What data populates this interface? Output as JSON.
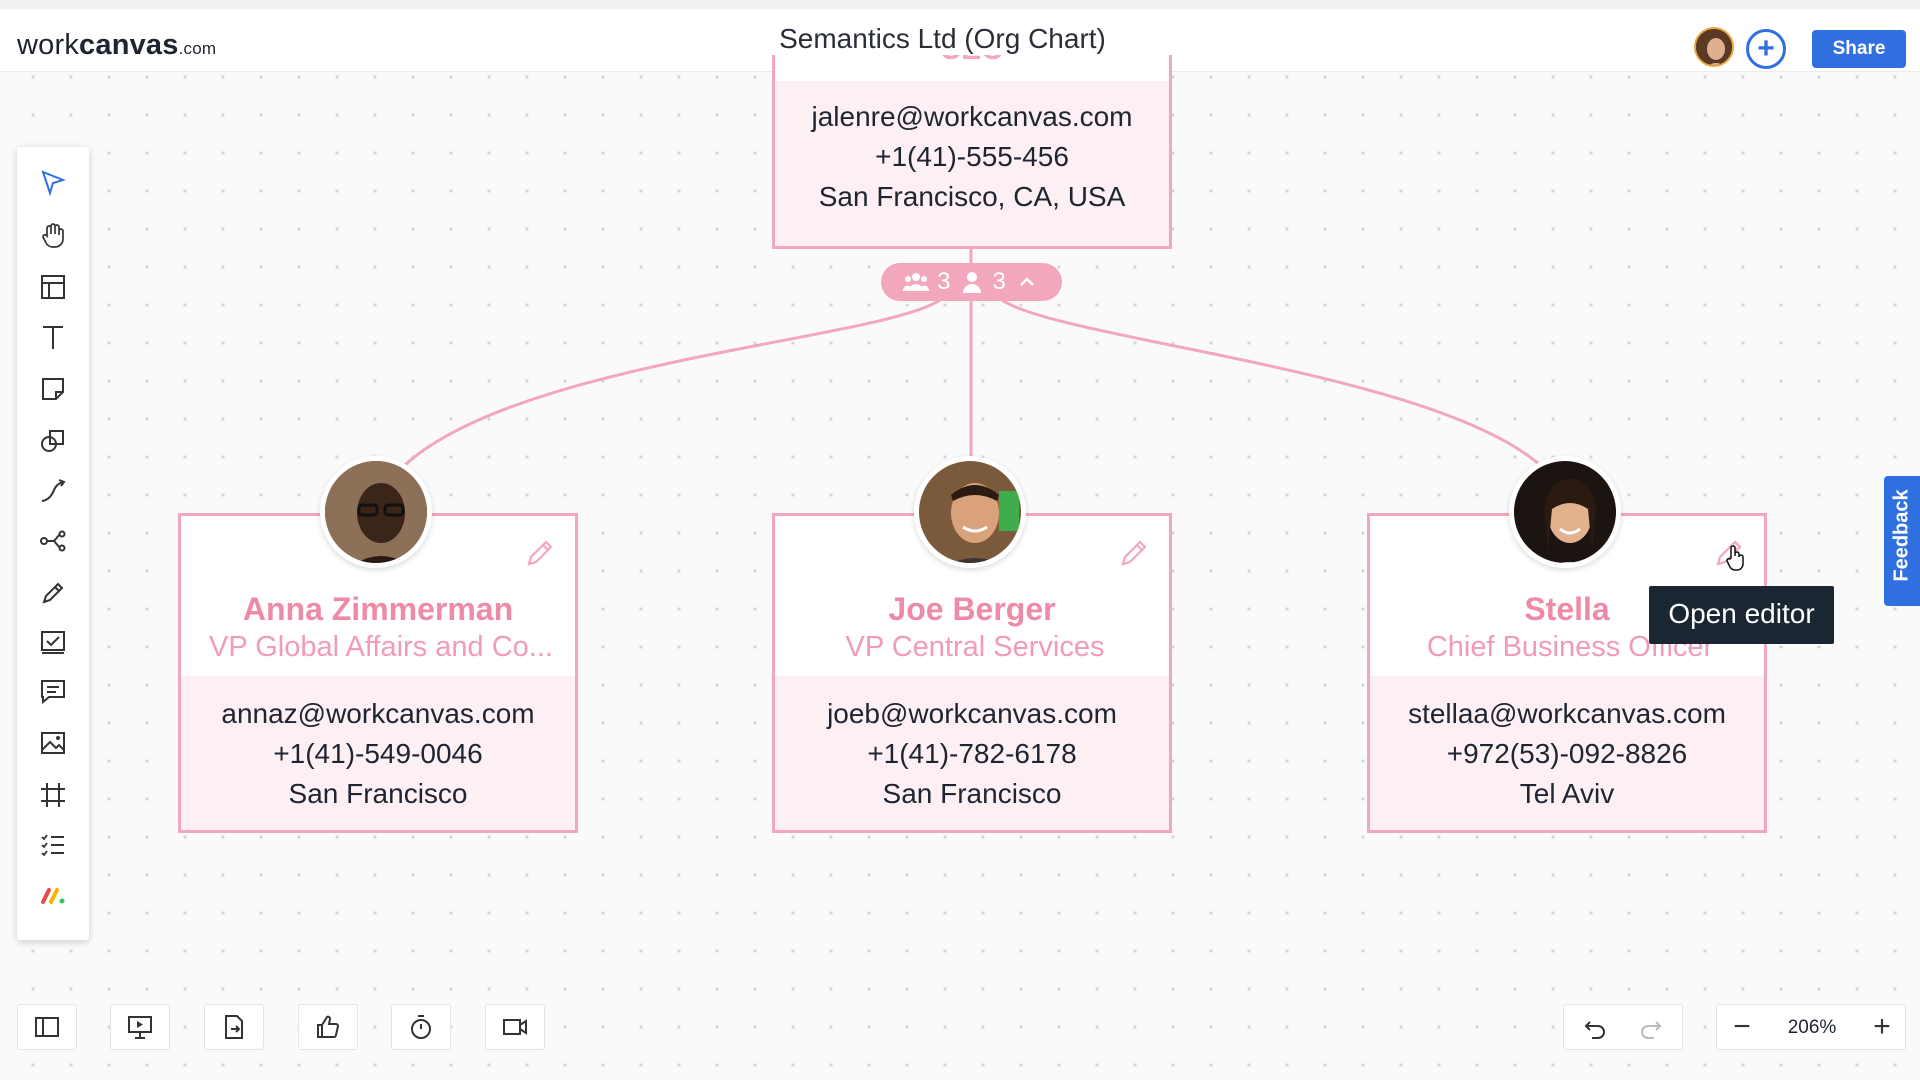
{
  "app": {
    "logo_main": "work",
    "logo_bold": "canvas",
    "logo_suffix": ".com",
    "title": "Semantics Ltd (Org Chart)",
    "share_label": "Share",
    "add_label": "+"
  },
  "toolbar": {
    "tools": [
      "select-icon",
      "hand-icon",
      "layout-icon",
      "text-icon",
      "sticky-note-icon",
      "shapes-icon",
      "connector-icon",
      "mindmap-icon",
      "pen-icon",
      "checklist-icon",
      "comment-icon",
      "image-icon",
      "frame-icon",
      "list-icon",
      "apps-icon"
    ]
  },
  "top_card": {
    "cut_text": "CEO",
    "email": "jalenre@workcanvas.com",
    "phone": "+1(41)-555-456",
    "location": "San Francisco, CA, USA"
  },
  "badge": {
    "teams": "3",
    "people": "3"
  },
  "cards": [
    {
      "name": "Anna Zimmerman",
      "role": "VP Global Affairs and Co...",
      "email": "annaz@workcanvas.com",
      "phone": "+1(41)-549-0046",
      "location": "San Francisco"
    },
    {
      "name": "Joe Berger",
      "role": "VP Central Services",
      "email": "joeb@workcanvas.com",
      "phone": "+1(41)-782-6178",
      "location": "San Francisco"
    },
    {
      "name": "Stella",
      "role": "Chief Business Officer",
      "email": "stellaa@workcanvas.com",
      "phone": "+972(53)-092-8826",
      "location": "Tel Aviv"
    }
  ],
  "tooltip": "Open editor",
  "feedback_label": "Feedback",
  "zoom": {
    "value": "206%",
    "minus": "−",
    "plus": "+"
  },
  "colors": {
    "accent": "#2f6fe0",
    "card_border": "#f3a7bd",
    "card_bg": "#fdf0f4",
    "name_pink": "#ef8aa6"
  }
}
